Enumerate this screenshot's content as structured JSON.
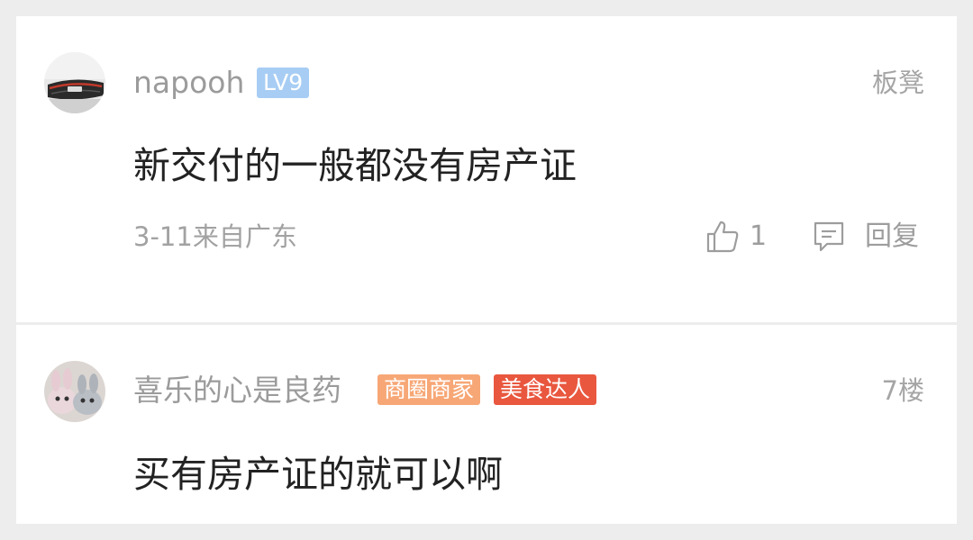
{
  "comments": [
    {
      "username": "napooh",
      "level_badge": "LV9",
      "floor": "板凳",
      "text": "新交付的一般都没有房产证",
      "meta": "3-11来自广东",
      "like_count": "1",
      "reply_label": "回复",
      "avatar_icon": "car-grille-avatar"
    },
    {
      "username": "喜乐的心是良药",
      "badges": [
        "商圈商家",
        "美食达人"
      ],
      "floor": "7楼",
      "text": "买有房产证的就可以啊",
      "avatar_icon": "plush-rabbits-avatar"
    }
  ],
  "colors": {
    "level_badge": "#a7cdf4",
    "merchant_badge": "#f7a776",
    "food_badge": "#e9573f",
    "secondary_text": "#9b9b9b",
    "primary_text": "#222222"
  },
  "icons": {
    "like": "thumbs-up-icon",
    "reply": "comment-bubble-icon"
  }
}
